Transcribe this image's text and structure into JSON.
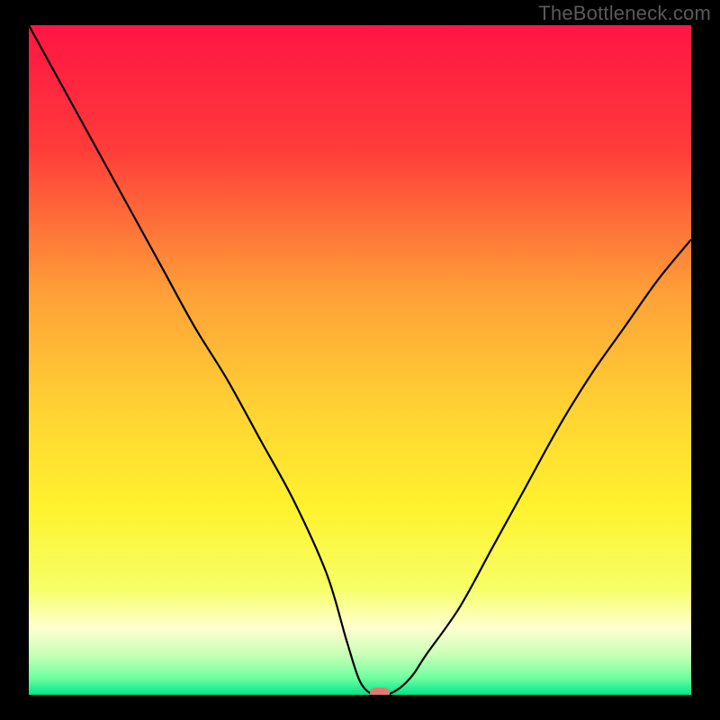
{
  "source_label": "TheBottleneck.com",
  "chart_data": {
    "type": "line",
    "title": "",
    "xlabel": "",
    "ylabel": "",
    "xlim": [
      0,
      100
    ],
    "ylim": [
      0,
      100
    ],
    "x": [
      0,
      5,
      10,
      15,
      20,
      25,
      30,
      35,
      40,
      45,
      48,
      50,
      52,
      54,
      56,
      58,
      60,
      65,
      70,
      75,
      80,
      85,
      90,
      95,
      100
    ],
    "values": [
      100,
      91,
      82,
      73,
      64,
      55,
      47,
      38,
      29,
      18,
      8,
      2,
      0,
      0,
      1,
      3,
      6,
      13,
      22,
      31,
      40,
      48,
      55,
      62,
      68
    ],
    "marker": {
      "x": 53,
      "y": 0
    },
    "gradient_stops": [
      {
        "pos": 0.0,
        "color": "#ff1544"
      },
      {
        "pos": 0.18,
        "color": "#ff3a3a"
      },
      {
        "pos": 0.4,
        "color": "#ffa038"
      },
      {
        "pos": 0.58,
        "color": "#ffd433"
      },
      {
        "pos": 0.72,
        "color": "#fff22e"
      },
      {
        "pos": 0.84,
        "color": "#f6ff66"
      },
      {
        "pos": 0.9,
        "color": "#ffffd0"
      },
      {
        "pos": 0.94,
        "color": "#c9ffb8"
      },
      {
        "pos": 0.975,
        "color": "#6effa0"
      },
      {
        "pos": 1.0,
        "color": "#00e588"
      }
    ],
    "curve_color": "#000000",
    "marker_color": "#e07a6f"
  }
}
